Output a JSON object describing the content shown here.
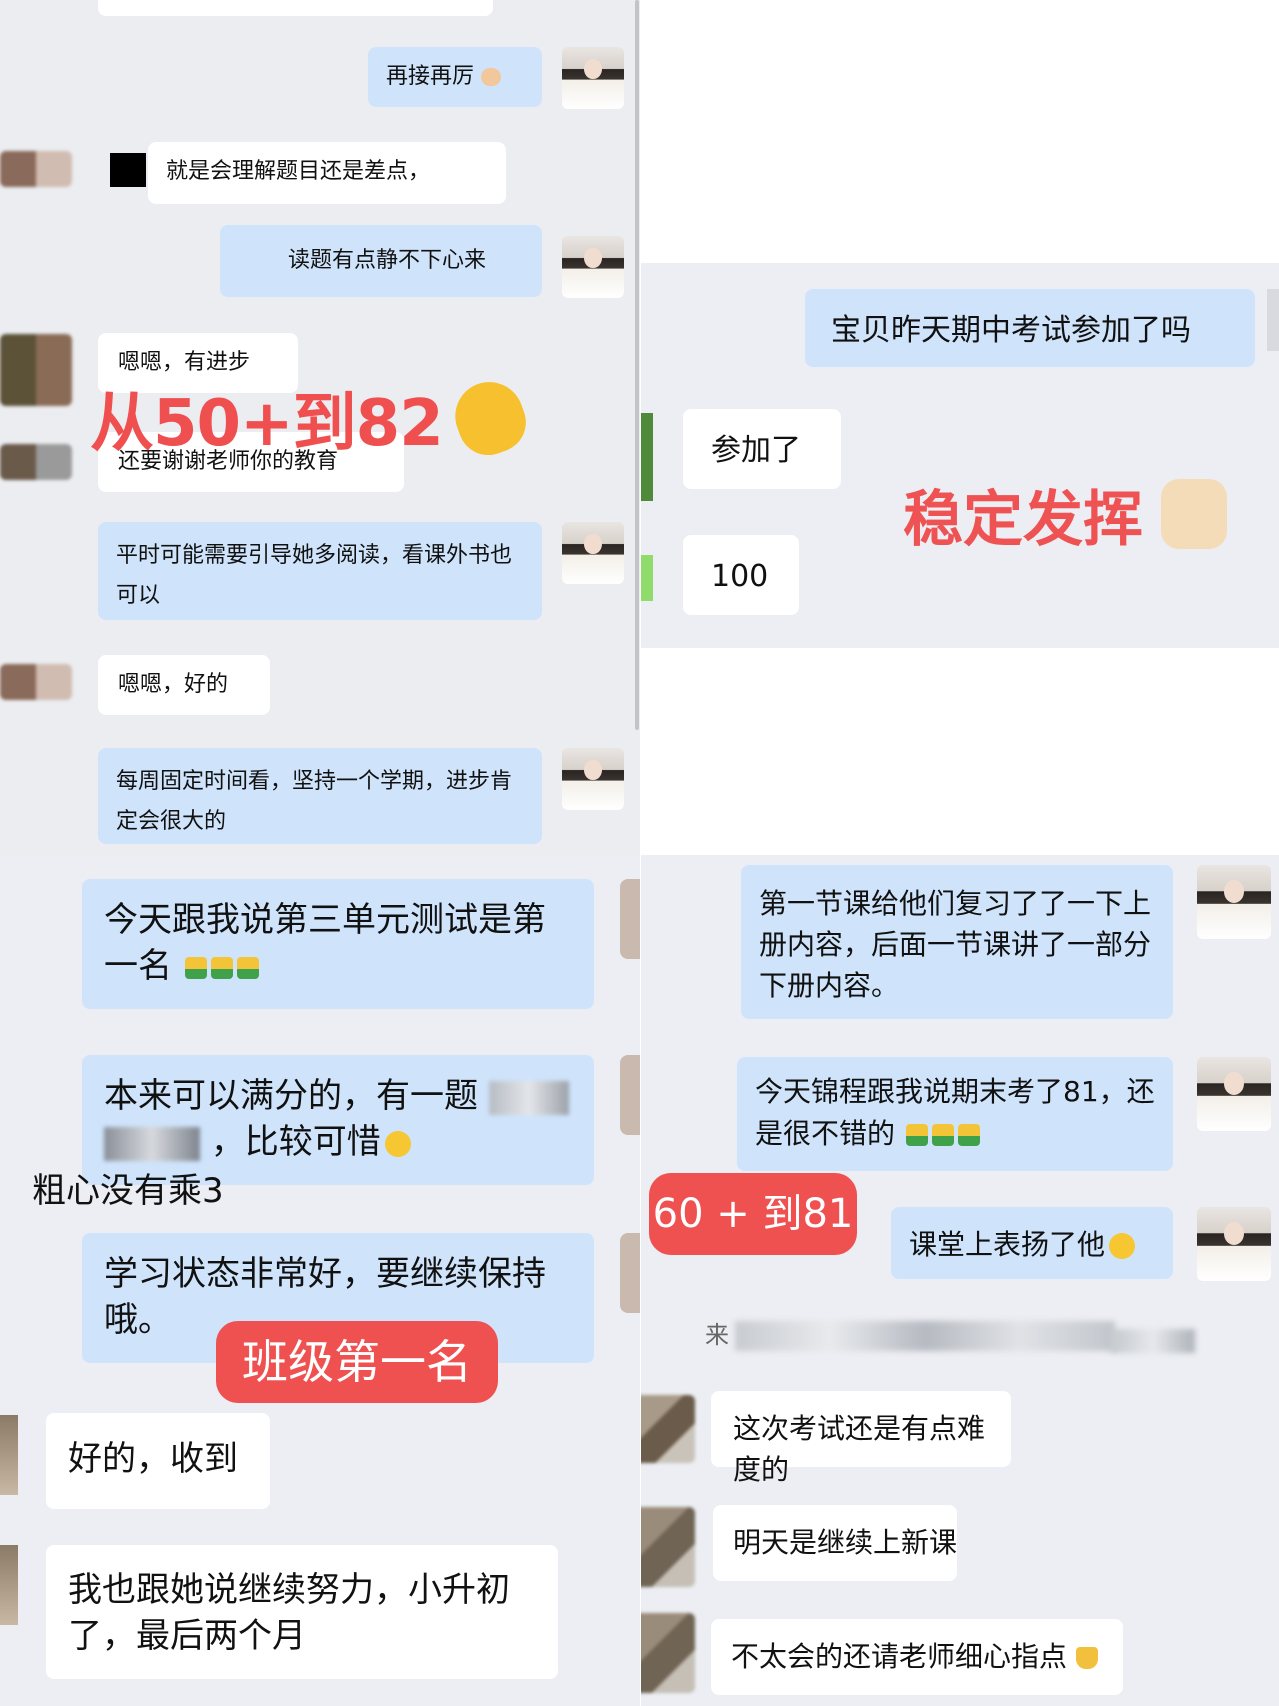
{
  "panel_a": {
    "m1": "再接再厉",
    "m2": "就是会理解题目还是差点，",
    "m3": "读题有点静不下心来",
    "m4": "嗯嗯，有进步",
    "m5": "还要谢谢老师你的教育",
    "m6": "平时可能需要引导她多阅读，看课外书也可以",
    "m7": "嗯嗯，好的",
    "m8": "每周固定时间看，坚持一个学期，进步肯定会很大的",
    "overlay": "从50+到82"
  },
  "panel_b": {
    "m1": "宝贝昨天期中考试参加了吗",
    "m2": "参加了",
    "m3": "100",
    "overlay": "稳定发挥"
  },
  "panel_c": {
    "m1": "今天跟我说第三单元测试是第一名",
    "m2a": "本来可以满分的，有一题",
    "m2b": "，比较可惜",
    "note": "粗心没有乘3",
    "m3": "学习状态非常好，要继续保持哦。",
    "tag": "班级第一名",
    "m4": "好的，收到",
    "m5": "我也跟她说继续努力，小升初了，最后两个月"
  },
  "panel_d": {
    "m1": "第一节课给他们复习了了一下上册内容，后面一节课讲了一部分下册内容。",
    "m2": "今天锦程跟我说期末考了81，还是很不错的",
    "tag": "60 + 到81",
    "m3": "课堂上表扬了他",
    "blur_prefix": "来",
    "m4": "这次考试还是有点难度的",
    "m5": "明天是继续上新课",
    "m6": "不太会的还请老师细心指点"
  },
  "colors": {
    "teacher_bubble": "#cfe4fb",
    "parent_bubble": "#ffffff",
    "overlay_red": "#ef5050",
    "chat_bg": "#ebedf1"
  },
  "icons": [
    "teacher-avatar",
    "parent-avatar",
    "thumbs-up-icon",
    "clap-icon",
    "smile-icon",
    "pray-icon",
    "muscle-icon"
  ]
}
